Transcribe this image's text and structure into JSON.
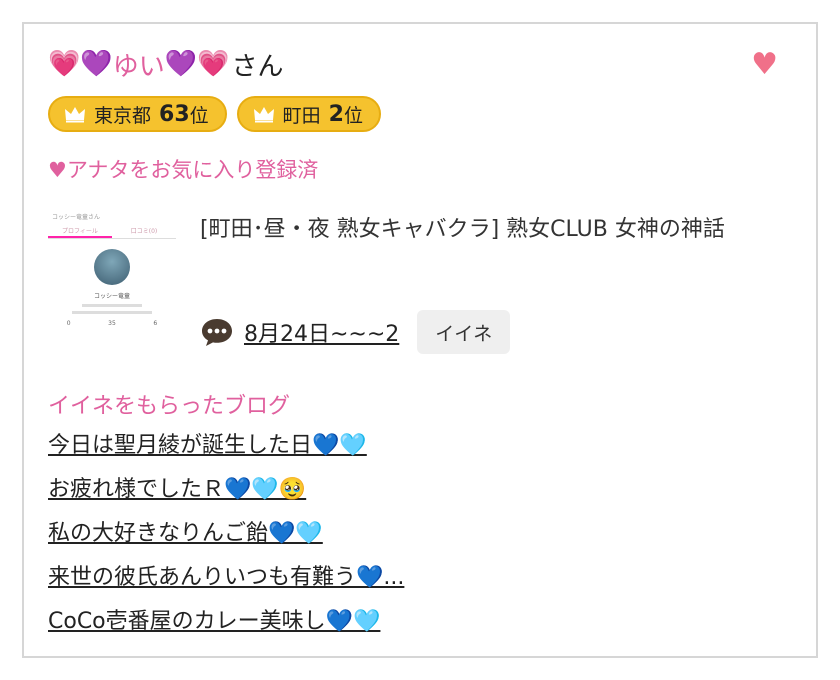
{
  "profile": {
    "hearts_left": "💗💜",
    "name": "ゆい",
    "hearts_right": "💜💗",
    "suffix": "さん",
    "favorite_icon": "heart-icon"
  },
  "rankings": [
    {
      "area": "東京都",
      "rank": "63",
      "unit": "位"
    },
    {
      "area": "町田",
      "rank": "2",
      "unit": "位"
    }
  ],
  "favorite_status": "♥アナタをお気に入り登録済",
  "thumbnail": {
    "header": "コッシー竜童さん",
    "tabs": [
      "プロフィール",
      "口コミ(0)"
    ],
    "name": "コッシー竜童",
    "stats": [
      "0",
      "35",
      "6"
    ]
  },
  "shop": {
    "title": "[町田･昼・夜 熟女キャバクラ]  熟女CLUB 女神の神話"
  },
  "comment": {
    "icon": "speech-bubble-icon",
    "text": "8月24日~~~2",
    "like_button": "イイネ"
  },
  "liked_blogs": {
    "heading": "イイネをもらったブログ",
    "items": [
      "今日は聖月綾が誕生した日💙🩵",
      "お疲れ様でしたＲ💙🩵🥹",
      "私の大好きなりんご飴💙🩵",
      "来世の彼氏あんりいつも有難う💙...",
      "CoCo壱番屋のカレー美味し💙🩵"
    ]
  },
  "colors": {
    "accent_pink": "#e0609e",
    "badge_gold": "#f5c22e",
    "heart_red": "#f07089"
  }
}
